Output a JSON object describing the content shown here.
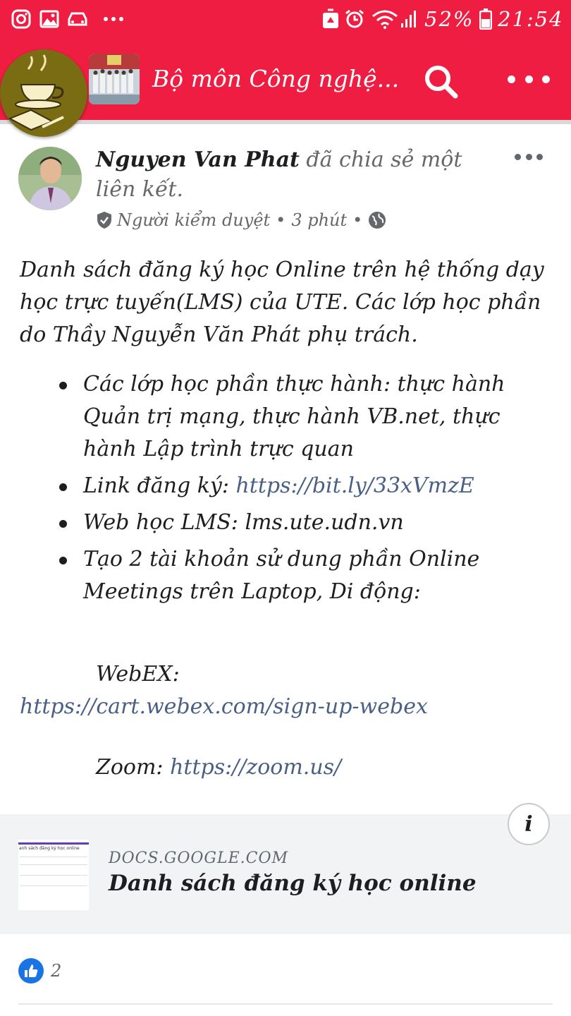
{
  "status_bar": {
    "battery": "52%",
    "time": "21:54",
    "left_icons": [
      "instagram-icon",
      "gallery-icon",
      "car-icon",
      "more-notifications-icon"
    ],
    "right_icons": [
      "recycle-icon",
      "alarm-icon",
      "wifi-icon",
      "signal-icon",
      "battery-icon"
    ]
  },
  "header": {
    "group_title": "Bộ môn Công nghệ...",
    "search_icon": "search-icon",
    "more_icon": "more-horizontal-icon",
    "brand_color": "#ef1d41"
  },
  "post": {
    "author": "Nguyen Van Phat",
    "action": " đã chia sẻ một liên kết.",
    "role": "Người kiểm duyệt",
    "time": "3 phút",
    "separator": "•",
    "privacy_icon": "globe-icon",
    "intro": "Danh sách đăng ký học Online trên hệ thống dạy học trực tuyến(LMS) của UTE. Các lớp học phần do Thầy Nguyễn Văn Phát phụ trách.",
    "bullets": {
      "b1": "Các lớp học phần thực hành: thực hành Quản trị mạng, thực hành VB.net, thực hành Lập trình trực quan",
      "b2_label": "Link đăng ký: ",
      "b2_link": "https://bit.ly/33xVmzE",
      "b3": "Web học LMS: lms.ute.udn.vn",
      "b4": "Tạo 2 tài khoản sử dung phần Online Meetings trên Laptop, Di động:"
    },
    "webex_label": "WebEX:",
    "webex_link": "https://cart.webex.com/sign-up-webex",
    "zoom_label": "Zoom: ",
    "zoom_link": "https://zoom.us/"
  },
  "link_card": {
    "domain": "DOCS.GOOGLE.COM",
    "title": "Danh sách đăng ký học online",
    "thumb_caption": "anh sách đăng ký học online",
    "info_label": "i"
  },
  "reactions": {
    "like_count": "2",
    "like_color": "#1b74e4"
  }
}
